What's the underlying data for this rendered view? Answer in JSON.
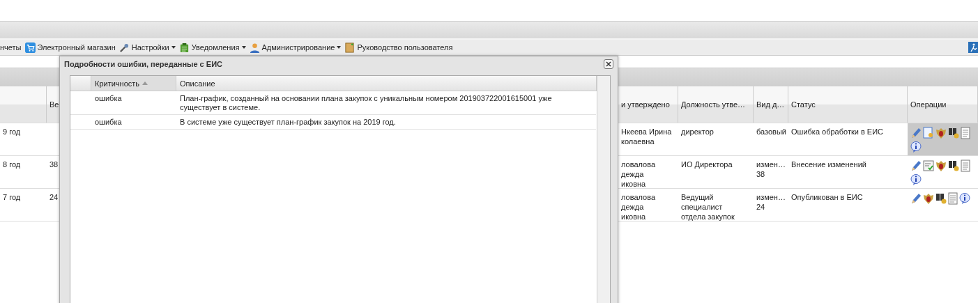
{
  "toolbar": [
    {
      "label": "нчеты",
      "kind": "none",
      "dropdown": false
    },
    {
      "label": "Электронный магазин",
      "kind": "cart",
      "dropdown": false
    },
    {
      "label": "Настройки",
      "kind": "wrench",
      "dropdown": true
    },
    {
      "label": "Уведомления",
      "kind": "clipboard",
      "dropdown": true
    },
    {
      "label": "Администрирование",
      "kind": "person",
      "dropdown": true
    },
    {
      "label": "Руководство пользователя",
      "kind": "book",
      "dropdown": false
    }
  ],
  "grid": {
    "columns": [
      "",
      "Ве",
      "и утверждено",
      "Должность утве…",
      "Вид д…",
      "Статус",
      "Операции"
    ],
    "rows": [
      {
        "cells": [
          "9 год",
          "",
          "Нкеева Ирина\nколаевна",
          "директор",
          "базовый",
          "Ошибка обработки в ЕИС"
        ],
        "ops_highlighted": true,
        "operations": [
          {
            "kind": "edit"
          },
          {
            "kind": "doc-key"
          },
          {
            "kind": "emblem"
          },
          {
            "kind": "binoculars"
          },
          {
            "kind": "doc"
          },
          {
            "kind": "info"
          }
        ]
      },
      {
        "cells": [
          "8 год",
          "38",
          "ловалова\nдежда\nиковна",
          "ИО Директора",
          "измен…\n38",
          "Внесение изменений"
        ],
        "ops_highlighted": false,
        "operations": [
          {
            "kind": "edit"
          },
          {
            "kind": "doc-check"
          },
          {
            "kind": "emblem"
          },
          {
            "kind": "binoculars"
          },
          {
            "kind": "doc"
          },
          {
            "kind": "info"
          }
        ]
      },
      {
        "cells": [
          "7 год",
          "24",
          "ловалова\nдежда\nиковна",
          "Ведущий\nспециалист\nотдела закупок",
          "измен…\n24",
          "Опубликован в ЕИС"
        ],
        "ops_highlighted": false,
        "operations": [
          {
            "kind": "edit"
          },
          {
            "kind": "emblem"
          },
          {
            "kind": "binoculars"
          },
          {
            "kind": "doc"
          },
          {
            "kind": "info"
          }
        ]
      }
    ]
  },
  "dialog": {
    "title": "Подробности ошибки, переданные с ЕИС",
    "columns": [
      {
        "label": "Критичность",
        "sorted": true
      },
      {
        "label": "Описание",
        "sorted": false
      }
    ],
    "rows": [
      [
        "ошибка",
        "План-график, созданный на основании плана закупок с уникальным номером 201903722001615001 уже существует в системе."
      ],
      [
        "ошибка",
        "В системе уже существует план-график закупок на 2019 год."
      ]
    ]
  }
}
